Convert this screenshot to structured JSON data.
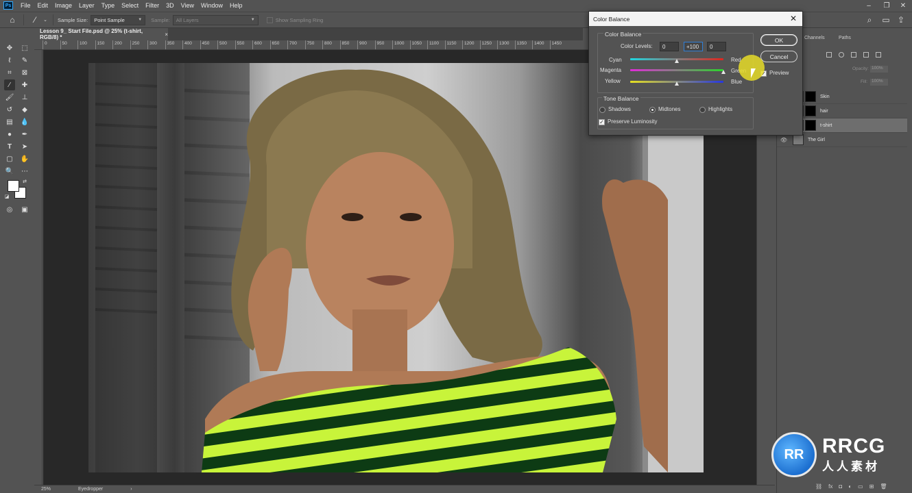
{
  "app": {
    "logo_text": "Ps",
    "menu": [
      "File",
      "Edit",
      "Image",
      "Layer",
      "Type",
      "Select",
      "Filter",
      "3D",
      "View",
      "Window",
      "Help"
    ]
  },
  "options_bar": {
    "sample_size_label": "Sample Size:",
    "sample_size_value": "Point Sample",
    "sample_label": "Sample:",
    "sample_value": "All Layers",
    "sampling_ring_label": "Show Sampling Ring"
  },
  "document": {
    "tab_title": "Lesson 9_ Start File.psd @ 25% (t-shirt, RGB/8) *",
    "close_symbol": "×",
    "ruler_ticks": [
      "0",
      "50",
      "100",
      "150",
      "200",
      "250",
      "300",
      "350",
      "400",
      "450",
      "500",
      "550",
      "600",
      "650",
      "700",
      "750",
      "800",
      "850",
      "900",
      "950",
      "1000",
      "1050",
      "1100",
      "1150",
      "1200",
      "1250",
      "1300",
      "1350",
      "1400",
      "1450"
    ]
  },
  "status_bar": {
    "zoom": "25%",
    "tool": "Eyedropper"
  },
  "layers_panel": {
    "tabs": [
      "Channels",
      "Paths"
    ],
    "opacity_label": "Opacity:",
    "opacity_value": "100%",
    "fill_label": "Fill:",
    "fill_value": "100%",
    "layers": [
      {
        "name": "Skin",
        "selected": false
      },
      {
        "name": "hair",
        "selected": false
      },
      {
        "name": "t-shirt",
        "selected": true
      },
      {
        "name": "The Girl",
        "selected": false
      }
    ]
  },
  "dialog": {
    "title": "Color Balance",
    "close_symbol": "✕",
    "color_balance_group": "Color Balance",
    "color_levels_label": "Color Levels:",
    "levels": [
      "0",
      "+100",
      "0"
    ],
    "sliders": [
      {
        "left": "Cyan",
        "right": "Red",
        "value": 0,
        "gradient": [
          "#1fd7e0",
          "#e0261e"
        ]
      },
      {
        "left": "Magenta",
        "right": "Green",
        "value": 100,
        "gradient": [
          "#e02bd8",
          "#2ad52a"
        ]
      },
      {
        "left": "Yellow",
        "right": "Blue",
        "value": 0,
        "gradient": [
          "#e6e021",
          "#2737e0"
        ]
      }
    ],
    "tone_balance_group": "Tone Balance",
    "tones": [
      {
        "label": "Shadows",
        "selected": false
      },
      {
        "label": "Midtones",
        "selected": true
      },
      {
        "label": "Highlights",
        "selected": false
      }
    ],
    "preserve_luminosity_label": "Preserve Luminosity",
    "preserve_luminosity_checked": true,
    "ok_label": "OK",
    "cancel_label": "Cancel",
    "preview_label": "Preview",
    "preview_checked": true
  },
  "watermark": {
    "logo_letters": "RR",
    "brand": "RRCG",
    "brand_cn": "人人素材"
  },
  "colors": {
    "ui_bg": "#535353",
    "canvas_bg": "#282828",
    "focus_blue": "#2f7fd8",
    "cursor_highlight": "#e6dc28"
  }
}
